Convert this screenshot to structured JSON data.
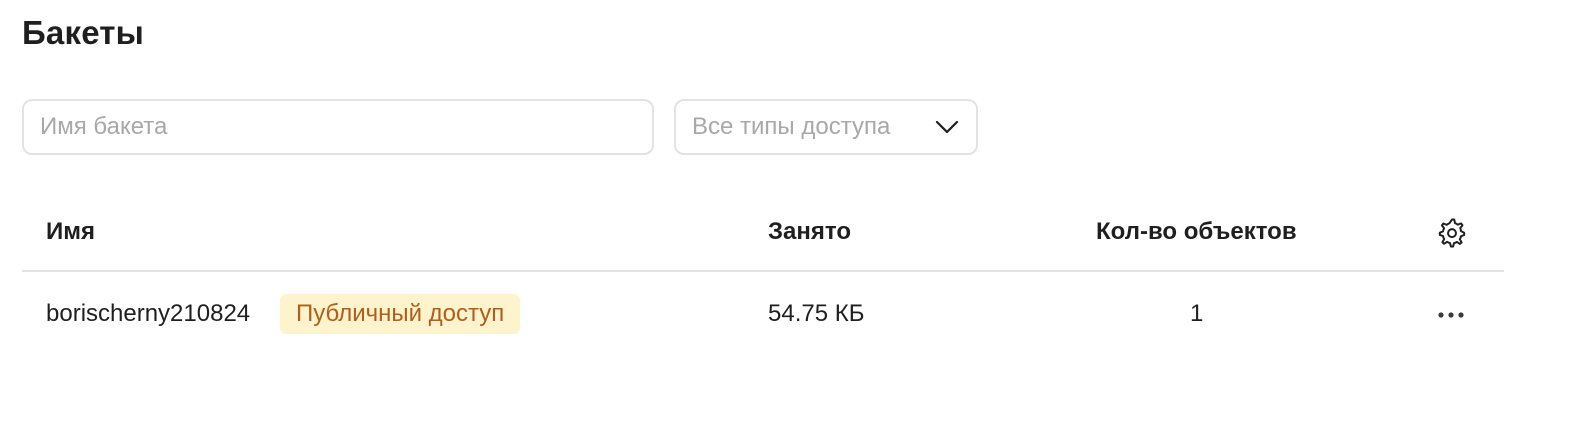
{
  "page": {
    "title": "Бакеты"
  },
  "filters": {
    "search_placeholder": "Имя бакета",
    "search_value": "",
    "access_select_value": "Все типы доступа"
  },
  "table": {
    "columns": {
      "name": "Имя",
      "used": "Занято",
      "count": "Кол-во объектов"
    },
    "rows": [
      {
        "name": "borischerny210824",
        "badge": "Публичный доступ",
        "used": "54.75 КБ",
        "count": "1"
      }
    ]
  },
  "icons": {
    "select_chevron": "chevron-down-icon",
    "table_settings": "gear-icon",
    "row_actions": "more-horizontal-icon"
  },
  "colors": {
    "badge_background": "#fdf3cd",
    "badge_text": "#b45d1a",
    "border": "#e3e3e3",
    "placeholder": "#a8a8a8"
  }
}
